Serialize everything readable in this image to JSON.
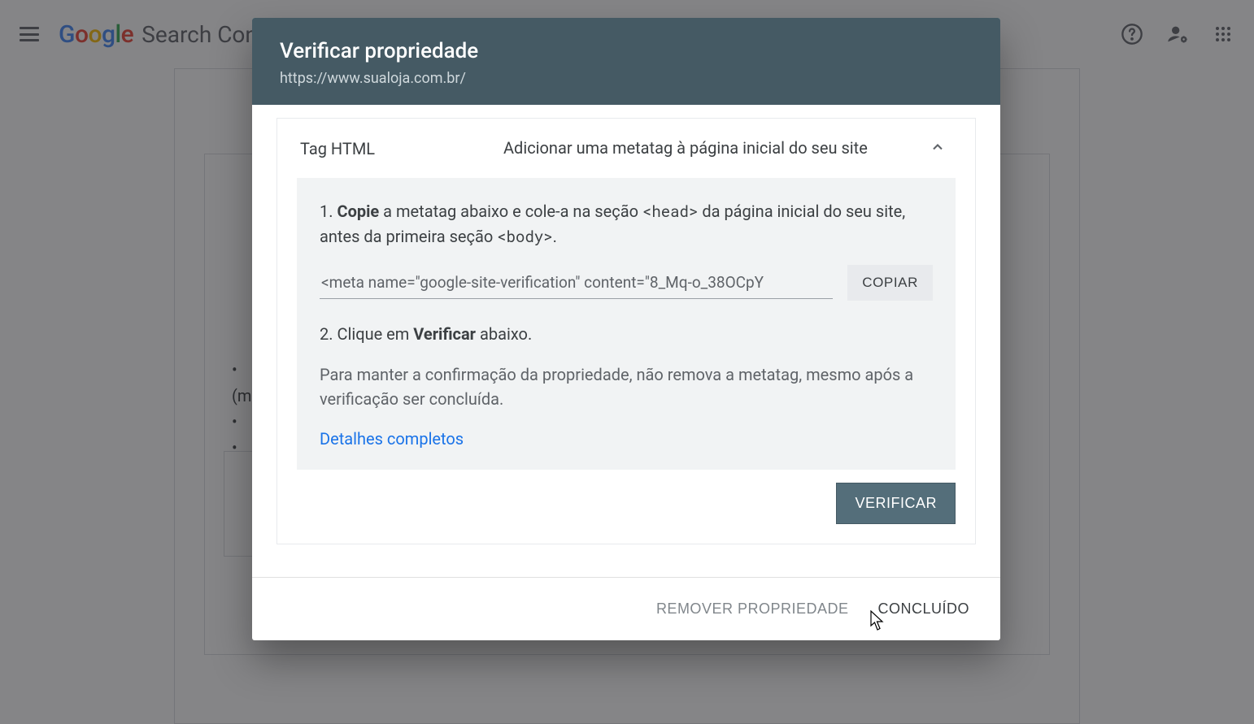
{
  "appbar": {
    "logo_prefix": "Google",
    "product": "Search Console"
  },
  "bg": {
    "bullet1": "•",
    "bullet2": "(m",
    "bullet3": "•",
    "bullet4": "•"
  },
  "dialog": {
    "title": "Verificar propriedade",
    "subtitle": "https://www.sualoja.com.br/",
    "panel": {
      "title": "Tag HTML",
      "description": "Adicionar uma metatag à página inicial do seu site"
    },
    "step1_prefix": "1. ",
    "step1_bold": "Copie",
    "step1_mid": " a metatag abaixo e cole-a na seção ",
    "step1_code1": "<head>",
    "step1_mid2": " da página inicial do seu site, antes da primeira seção ",
    "step1_code2": "<body>",
    "step1_end": ".",
    "metatag": "<meta name=\"google-site-verification\" content=\"8_Mq-o_38OCpY",
    "copy": "COPIAR",
    "step2_prefix": "2. Clique em ",
    "step2_bold": "Verificar",
    "step2_suffix": " abaixo.",
    "note": "Para manter a confirmação da propriedade, não remova a metatag, mesmo após a verificação ser concluída.",
    "details": "Detalhes completos",
    "verify": "VERIFICAR",
    "remove": "REMOVER PROPRIEDADE",
    "done": "CONCLUÍDO"
  }
}
